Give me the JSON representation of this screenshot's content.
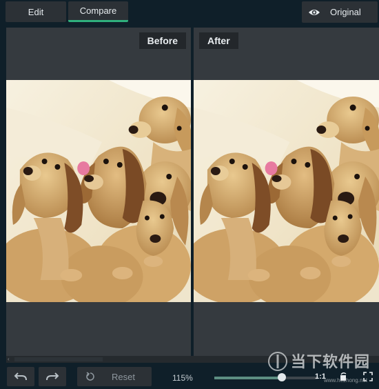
{
  "topbar": {
    "tabs": [
      {
        "label": "Edit",
        "active": false
      },
      {
        "label": "Compare",
        "active": true
      }
    ],
    "original_button": {
      "label": "Original",
      "icon": "eye-icon"
    }
  },
  "compare": {
    "before_label": "Before",
    "after_label": "After",
    "image_subject": "puppies"
  },
  "bottombar": {
    "undo_icon": "undo-icon",
    "redo_icon": "redo-icon",
    "reset_label": "Reset",
    "reset_icon": "reset-icon",
    "zoom_text": "115%",
    "zoom_slider_fraction": 0.65,
    "one_to_one_label": "1:1",
    "rotate_icon": "rotate-icon",
    "fullscreen_icon": "fullscreen-icon"
  },
  "watermark": {
    "title": "当下软件园",
    "url": "www.hezhong.net"
  },
  "colors": {
    "accent": "#2fb07d",
    "background": "#0f1f29",
    "panel": "#353a3f"
  }
}
